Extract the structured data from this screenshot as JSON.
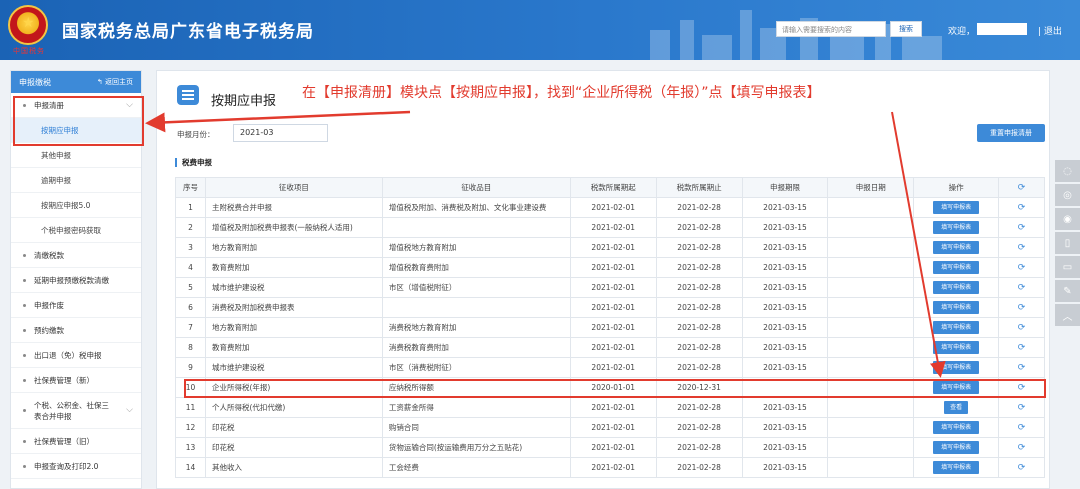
{
  "header": {
    "title": "国家税务总局广东省电子税务局",
    "emblem_text": "中国税务",
    "search_placeholder": "请输入需要搜索的内容",
    "search_button": "搜索",
    "welcome": "欢迎，",
    "logout": "| 退出"
  },
  "sidebar": {
    "head_title": "申报缴税",
    "back_label": "返回主页",
    "items": [
      {
        "label": "申报清册",
        "type": "group"
      },
      {
        "label": "按期应申报",
        "type": "sub"
      },
      {
        "label": "其他申报",
        "type": "sub"
      },
      {
        "label": "逾期申报",
        "type": "sub"
      },
      {
        "label": "按期应申报5.0",
        "type": "sub"
      },
      {
        "label": "个税申报密码获取",
        "type": "sub"
      },
      {
        "label": "清缴税款",
        "type": "item"
      },
      {
        "label": "延期申报预缴税款清缴",
        "type": "item"
      },
      {
        "label": "申报作废",
        "type": "item"
      },
      {
        "label": "预约缴款",
        "type": "item"
      },
      {
        "label": "出口退（免）税申报",
        "type": "item"
      },
      {
        "label": "社保费管理（新）",
        "type": "item"
      },
      {
        "label": "个税、公积金、社保三表合并申报",
        "type": "item"
      },
      {
        "label": "社保费管理（旧）",
        "type": "item"
      },
      {
        "label": "申报查询及打印2.0",
        "type": "item"
      }
    ]
  },
  "main": {
    "page_title": "按期应申报",
    "annotation": "在【申报清册】模块点【按期应申报】，找到“企业所得税（年报）”点【填写申报表】",
    "month_label": "申报月份：",
    "month_value": "2021-03",
    "reset_button": "重置申报清册",
    "section_title": "税费申报"
  },
  "table": {
    "headers": [
      "序号",
      "征收项目",
      "征收品目",
      "税款所属期起",
      "税款所属期止",
      "申报期限",
      "申报日期",
      "操作",
      "⟳"
    ],
    "rows": [
      [
        "1",
        "主附税费合并申报",
        "增值税及附加、消费税及附加、文化事业建设费",
        "2021-02-01",
        "2021-02-28",
        "2021-03-15",
        "",
        "填写申报表"
      ],
      [
        "2",
        "增值税及附加税费申报表(一般纳税人适用)",
        "",
        "2021-02-01",
        "2021-02-28",
        "2021-03-15",
        "",
        "填写申报表"
      ],
      [
        "3",
        "地方教育附加",
        "增值税地方教育附加",
        "2021-02-01",
        "2021-02-28",
        "2021-03-15",
        "",
        "填写申报表"
      ],
      [
        "4",
        "教育费附加",
        "增值税教育费附加",
        "2021-02-01",
        "2021-02-28",
        "2021-03-15",
        "",
        "填写申报表"
      ],
      [
        "5",
        "城市维护建设税",
        "市区（增值税附征）",
        "2021-02-01",
        "2021-02-28",
        "2021-03-15",
        "",
        "填写申报表"
      ],
      [
        "6",
        "消费税及附加税费申报表",
        "",
        "2021-02-01",
        "2021-02-28",
        "2021-03-15",
        "",
        "填写申报表"
      ],
      [
        "7",
        "地方教育附加",
        "消费税地方教育附加",
        "2021-02-01",
        "2021-02-28",
        "2021-03-15",
        "",
        "填写申报表"
      ],
      [
        "8",
        "教育费附加",
        "消费税教育费附加",
        "2021-02-01",
        "2021-02-28",
        "2021-03-15",
        "",
        "填写申报表"
      ],
      [
        "9",
        "城市维护建设税",
        "市区（消费税附征）",
        "2021-02-01",
        "2021-02-28",
        "2021-03-15",
        "",
        "填写申报表"
      ],
      [
        "10",
        "企业所得税(年报)",
        "应纳税所得额",
        "2020-01-01",
        "2020-12-31",
        "",
        "",
        "填写申报表"
      ],
      [
        "11",
        "个人所得税(代扣代缴)",
        "工资薪金所得",
        "2021-02-01",
        "2021-02-28",
        "2021-03-15",
        "",
        "查看"
      ],
      [
        "12",
        "印花税",
        "购销合同",
        "2021-02-01",
        "2021-02-28",
        "2021-03-15",
        "",
        "填写申报表"
      ],
      [
        "13",
        "印花税",
        "货物运输合同(按运输费用万分之五贴花)",
        "2021-02-01",
        "2021-02-28",
        "2021-03-15",
        "",
        "填写申报表"
      ],
      [
        "14",
        "其他收入",
        "工会经费",
        "2021-02-01",
        "2021-02-28",
        "2021-03-15",
        "",
        "填写申报表"
      ]
    ]
  },
  "toolbar_icons": [
    "chat-icon",
    "chat-multi-icon",
    "weibo-icon",
    "mobile-icon",
    "tablet-icon",
    "edit-icon",
    "scroll-top-icon"
  ],
  "colors": {
    "primary": "#3d8ad8",
    "header": "#1b63b5",
    "annotation": "#e23b2e"
  }
}
